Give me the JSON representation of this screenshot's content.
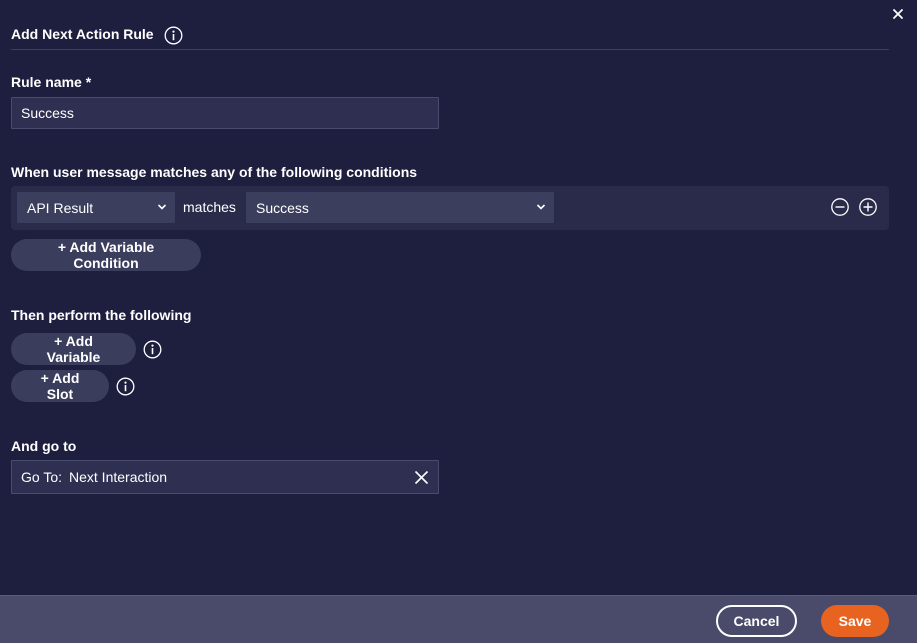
{
  "dialog": {
    "title": "Add Next Action Rule",
    "close_icon": "close-icon"
  },
  "rule_name": {
    "label": "Rule name *",
    "value": "Success"
  },
  "conditions": {
    "label": "When user message matches any of the following conditions",
    "rows": [
      {
        "variable": "API Result",
        "operator": "matches",
        "value": "Success"
      }
    ],
    "add_label": "+ Add Variable Condition"
  },
  "actions": {
    "label": "Then perform the following",
    "add_variable_label": "+ Add Variable",
    "add_slot_label": "+ Add Slot"
  },
  "goto": {
    "label": "And go to",
    "prefix": "Go To:",
    "value": "Next Interaction"
  },
  "footer": {
    "cancel_label": "Cancel",
    "save_label": "Save"
  },
  "colors": {
    "background": "#1e1f3f",
    "footer": "#4a4b6b",
    "accent": "#e8631f",
    "input": "#2f3051"
  }
}
